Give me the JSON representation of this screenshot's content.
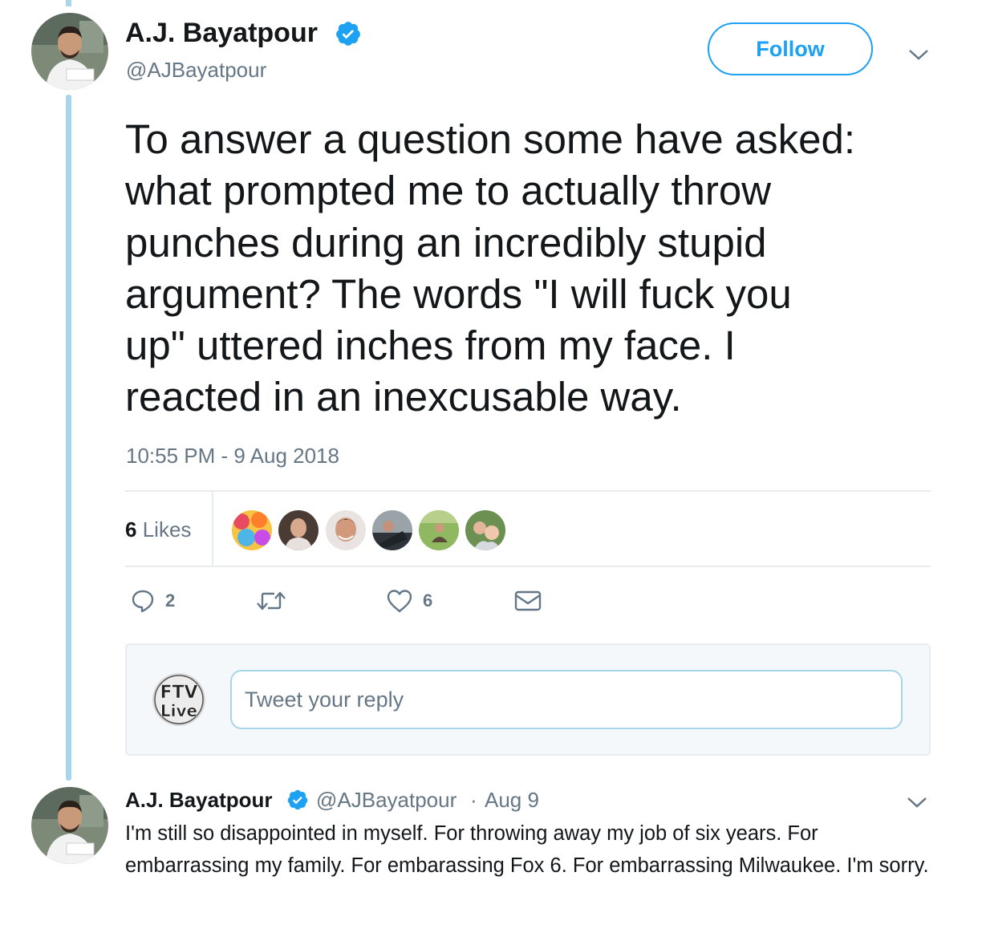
{
  "tweet": {
    "author_name": "A.J. Bayatpour",
    "author_handle": "@AJBayatpour",
    "follow_label": "Follow",
    "text": "To answer a question some have asked:\nwhat prompted me to actually throw\npunches during an incredibly stupid\nargument? The words \"I will fuck you\nup\" uttered inches from my face. I\nreacted in an inexcusable way.",
    "timestamp": "10:55 PM - 9 Aug 2018",
    "likes_count": "6",
    "likes_label": "Likes",
    "actions": {
      "reply_count": "2",
      "retweet_count": "",
      "like_count": "6"
    }
  },
  "reply_box": {
    "placeholder": "Tweet your reply",
    "avatar_text_top": "FTV",
    "avatar_text_bottom": "Live"
  },
  "reply": {
    "author_name": "A.J. Bayatpour",
    "author_handle": "@AJBayatpour",
    "separator": "·",
    "date": "Aug 9",
    "text": "I'm still so disappointed in myself. For throwing away my job of six years. For embarrassing my family. For embarassing Fox 6. For embarrassing Milwaukee. I'm sorry."
  },
  "colors": {
    "accent": "#1da1f2",
    "thread_line": "#a8d5e8",
    "muted_text": "#657786",
    "divider": "#e6ecf0"
  },
  "icons": [
    "verified-badge-icon",
    "chevron-down-icon",
    "reply-icon",
    "retweet-icon",
    "heart-icon",
    "mail-icon"
  ]
}
